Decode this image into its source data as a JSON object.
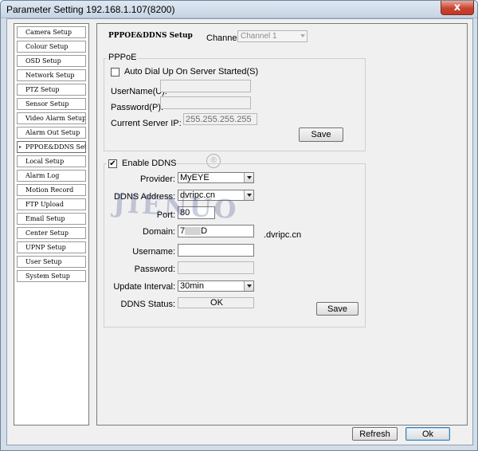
{
  "window": {
    "title": "Parameter Setting 192.168.1.107(8200)",
    "close_glyph": "x"
  },
  "sidebar": {
    "items": [
      {
        "label": "Camera Setup"
      },
      {
        "label": "Colour Setup"
      },
      {
        "label": "OSD Setup"
      },
      {
        "label": "Network Setup"
      },
      {
        "label": "PTZ Setup"
      },
      {
        "label": "Sensor Setup"
      },
      {
        "label": "Video Alarm Setup"
      },
      {
        "label": "Alarm Out Setup"
      },
      {
        "label": "PPPOE&DDNS Setup",
        "selected": true
      },
      {
        "label": "Local Setup"
      },
      {
        "label": "Alarm Log"
      },
      {
        "label": "Motion Record"
      },
      {
        "label": "FTP Upload"
      },
      {
        "label": "Email Setup"
      },
      {
        "label": "Center Setup"
      },
      {
        "label": "UPNP Setup"
      },
      {
        "label": "User Setup"
      },
      {
        "label": "System Setup"
      }
    ],
    "selected_marker": "▸"
  },
  "header": {
    "heading": "PPPOE&DDNS Setup",
    "channel_label": "Channel:",
    "channel_value": "Channel 1"
  },
  "pppoe": {
    "group_title": "PPPoE",
    "auto_dial_label": "Auto Dial Up On Server Started(S)",
    "auto_dial_checked": false,
    "username_label": "UserName(U):",
    "username_value": "",
    "password_label": "Password(P):",
    "password_value": "",
    "server_ip_label": "Current Server IP:",
    "server_ip_value": "255.255.255.255",
    "save_label": "Save"
  },
  "ddns": {
    "enable_label": "Enable DDNS",
    "enable_checked": true,
    "enable_mark": "✔",
    "provider_label": "Provider:",
    "provider_value": "MyEYE",
    "address_label": "DDNS Address:",
    "address_value": "dvripc.cn",
    "port_label": "Port:",
    "port_value": "80",
    "domain_label": "Domain:",
    "domain_prefix": "7",
    "domain_suffix_char": "D",
    "domain_suffix": ".dvripc.cn",
    "username_label": "Username:",
    "username_value": "",
    "password_label": "Password:",
    "password_value": "",
    "interval_label": "Update Interval:",
    "interval_value": "30min",
    "status_label": "DDNS Status:",
    "status_value": "OK",
    "save_label": "Save"
  },
  "footer": {
    "refresh_label": "Refresh",
    "ok_label": "Ok"
  },
  "branding": {
    "registered_mark": "®",
    "watermark_text": "JIENUO"
  }
}
